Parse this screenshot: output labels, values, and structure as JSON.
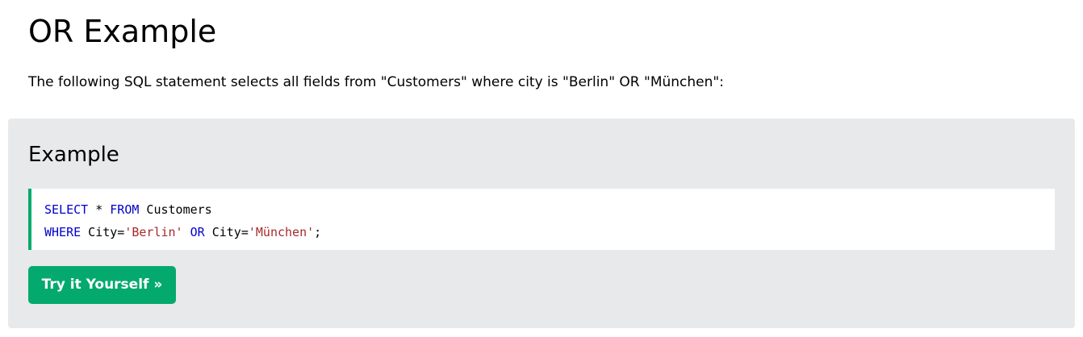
{
  "page": {
    "title": "OR Example",
    "intro": "The following SQL statement selects all fields from \"Customers\" where city is \"Berlin\" OR \"München\":"
  },
  "example": {
    "heading": "Example",
    "code": {
      "line1": {
        "t1": "SELECT",
        "t2": " * ",
        "t3": "FROM",
        "t4": " Customers"
      },
      "line2": {
        "t1": "WHERE",
        "t2": " City=",
        "t3": "'Berlin'",
        "t4": " ",
        "t5": "OR",
        "t6": " City=",
        "t7": "'München'",
        "t8": ";"
      }
    },
    "button_label": "Try it Yourself »"
  },
  "colors": {
    "accent": "#04aa6d",
    "panel_background": "#e7e9eb",
    "keyword": "#0000cd",
    "string": "#a52a2a"
  }
}
